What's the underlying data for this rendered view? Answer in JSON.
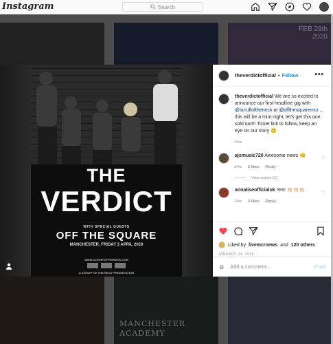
{
  "topbar": {
    "logo": "Instagram",
    "search_placeholder": "Search",
    "icons": [
      "home-icon",
      "direct-icon",
      "explore-icon",
      "activity-heart-icon",
      "profile-avatar"
    ]
  },
  "background_tiles": {
    "tile3_date_line1": "FEB 29th",
    "tile3_date_line2": "2020",
    "tile5_text_line1": "MANCHESTER",
    "tile5_text_line2": "ACADEMY"
  },
  "poster": {
    "title_top": "THE",
    "title_main": "VERDICT",
    "guests_label": "WITH SPECIAL GUESTS",
    "support": "OFF THE SQUARE",
    "date_line": "MANCHESTER, FRIDAY 3 APRIL 2020",
    "url": "WWW.SCRUFFOFTHENECK.COM",
    "presenter": "A SCRUFF OF THE NECK PRESENTATION"
  },
  "post": {
    "username": "theverdictofficial",
    "separator": "•",
    "follow_label": "Follow",
    "more_label": "•••",
    "caption_user": "theverdictofficial",
    "caption_pre": "We are so excited to announce our first headline gig with ",
    "mention1": "@scruffoftheneck",
    "caption_mid": " at ",
    "mention2": "@offthesquaremcr",
    "caption_post": ".... this will be a mint night, let's get this one sold out!!! Ticket link to follow, keep an eye on our story 🙂",
    "caption_age": "54w",
    "comments": [
      {
        "user": "ajsmusic720",
        "text": "Awesome news 👊",
        "age": "54w",
        "likes": "2 likes",
        "reply": "Reply",
        "view_replies": "View replies (1)"
      },
      {
        "user": "annaliseofficialuk",
        "text": "Yes! 👏🏻👏🏻👏🏻",
        "age": "54w",
        "likes": "2 likes",
        "reply": "Reply"
      }
    ],
    "liked_by_prefix": "Liked by",
    "liked_by_user": "livemcrnews",
    "liked_by_and": "and",
    "liked_by_others": "120 others",
    "date": "JANUARY 14, 2020",
    "add_comment_placeholder": "Add a comment...",
    "post_label": "Post"
  },
  "colors": {
    "link_blue": "#0095f6",
    "like_red": "#ed4956",
    "post_disabled": "#b2dffc"
  }
}
